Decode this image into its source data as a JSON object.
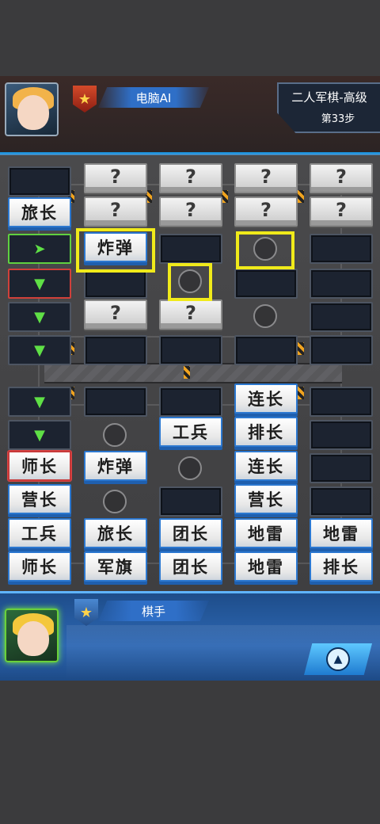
{
  "opponent": {
    "name": "电脑AI",
    "avatar_icon": "anime-boy-avatar"
  },
  "game_info": {
    "title": "二人军棋-高级",
    "step": "第33步"
  },
  "player": {
    "name": "棋手",
    "avatar_icon": "anime-girl-avatar"
  },
  "colors": {
    "highlight": "#f0ea1a",
    "player_piece_border": "#2c78d0",
    "panel_blue": "#2d67b3"
  },
  "board": {
    "unknown_label": "?",
    "arrow_right": "➤",
    "arrow_down": "▼",
    "pieces": {
      "r2c1": "旅长",
      "r3c2": "炸弹",
      "r7c4": "连长",
      "r8c3": "工兵",
      "r8c4": "排长",
      "r9c1": "师长",
      "r9c2": "炸弹",
      "r9c4": "连长",
      "r10c1": "营长",
      "r10c4": "营长",
      "r11c1": "工兵",
      "r11c2": "旅长",
      "r11c3": "团长",
      "r11c4": "地雷",
      "r11c5": "地雷",
      "r12c1": "师长",
      "r12c2": "军旗",
      "r12c3": "团长",
      "r12c4": "地雷",
      "r12c5": "排长"
    }
  }
}
